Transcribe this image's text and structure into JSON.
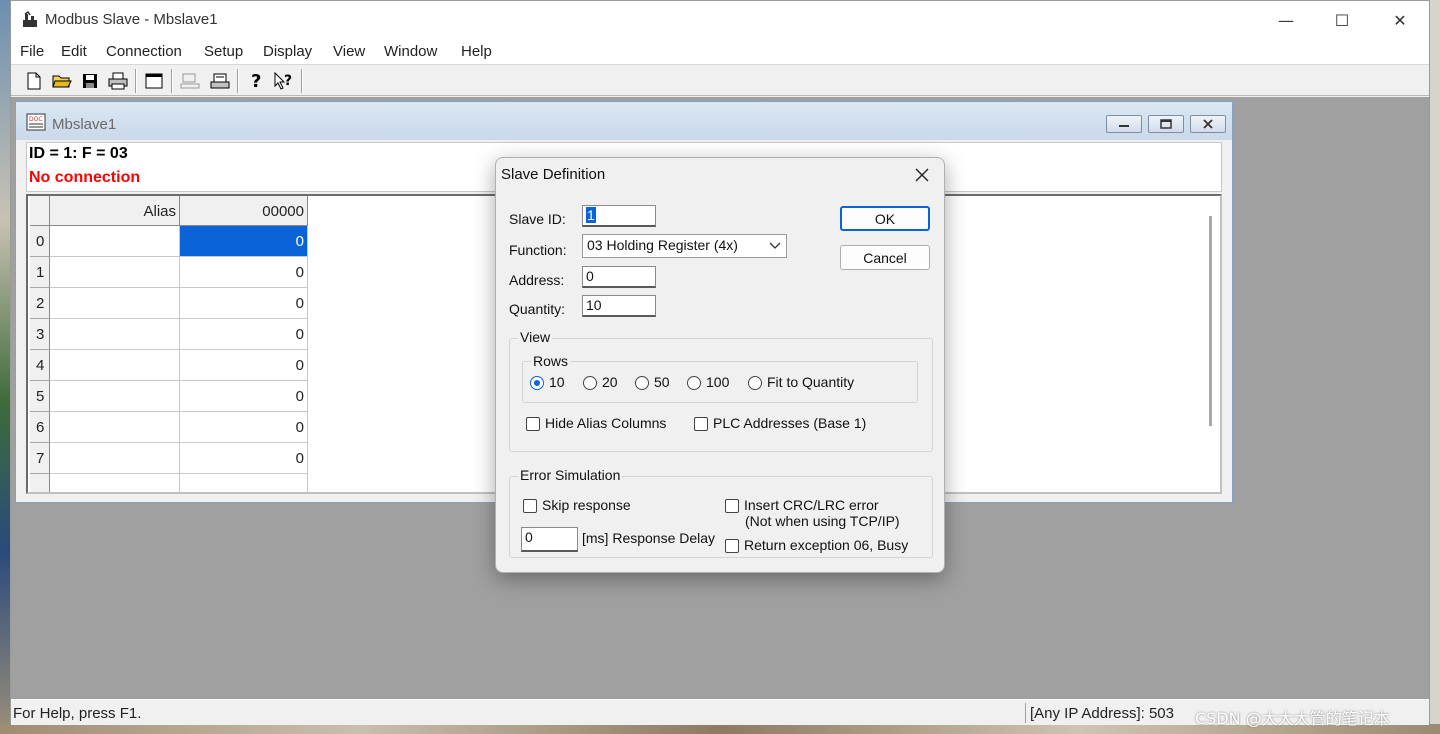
{
  "window": {
    "title": "Modbus Slave - Mbslave1",
    "minimize_glyph": "—",
    "maximize_glyph": "☐",
    "close_glyph": "✕"
  },
  "menu": [
    "File",
    "Edit",
    "Connection",
    "Setup",
    "Display",
    "View",
    "Window",
    "Help"
  ],
  "toolbar": {
    "icons": [
      "new-file-icon",
      "open-folder-icon",
      "save-icon",
      "print-icon",
      "window-icon",
      "disabled-printer-icon",
      "connect-icon",
      "help-icon",
      "context-help-icon"
    ]
  },
  "child_window": {
    "title": "Mbslave1",
    "info_line": "ID = 1: F = 03",
    "connection_status": "No connection",
    "connection_color": "#ff0000",
    "table": {
      "columns": [
        "Alias",
        "00000"
      ],
      "rows": [
        {
          "index": "0",
          "alias": "",
          "value": "0"
        },
        {
          "index": "1",
          "alias": "",
          "value": "0"
        },
        {
          "index": "2",
          "alias": "",
          "value": "0"
        },
        {
          "index": "3",
          "alias": "",
          "value": "0"
        },
        {
          "index": "4",
          "alias": "",
          "value": "0"
        },
        {
          "index": "5",
          "alias": "",
          "value": "0"
        },
        {
          "index": "6",
          "alias": "",
          "value": "0"
        },
        {
          "index": "7",
          "alias": "",
          "value": "0"
        }
      ]
    }
  },
  "dialog": {
    "title": "Slave Definition",
    "slave_id_label": "Slave ID:",
    "slave_id_value": "1",
    "function_label": "Function:",
    "function_value": "03 Holding Register (4x)",
    "address_label": "Address:",
    "address_value": "0",
    "quantity_label": "Quantity:",
    "quantity_value": "10",
    "ok_label": "OK",
    "cancel_label": "Cancel",
    "view_group_label": "View",
    "rows_group_label": "Rows",
    "row_options": [
      {
        "label": "10",
        "selected": true
      },
      {
        "label": "20",
        "selected": false
      },
      {
        "label": "50",
        "selected": false
      },
      {
        "label": "100",
        "selected": false
      },
      {
        "label": "Fit to Quantity",
        "selected": false
      }
    ],
    "hide_alias_label": "Hide Alias Columns",
    "plc_addresses_label": "PLC Addresses (Base 1)",
    "error_group_label": "Error Simulation",
    "skip_response_label": "Skip response",
    "insert_crc_label": "Insert CRC/LRC error",
    "insert_crc_note": "(Not when using TCP/IP)",
    "response_delay_value": "0",
    "response_delay_label": "[ms] Response Delay",
    "return_exception_label": "Return exception 06, Busy"
  },
  "status": {
    "help_text": "For Help, press F1.",
    "ip_text": "[Any IP Address]: 503",
    "watermark": "CSDN @大大大管的笔记本"
  },
  "colors": {
    "selection": "#0a64d8",
    "error_text": "#ff0000"
  }
}
